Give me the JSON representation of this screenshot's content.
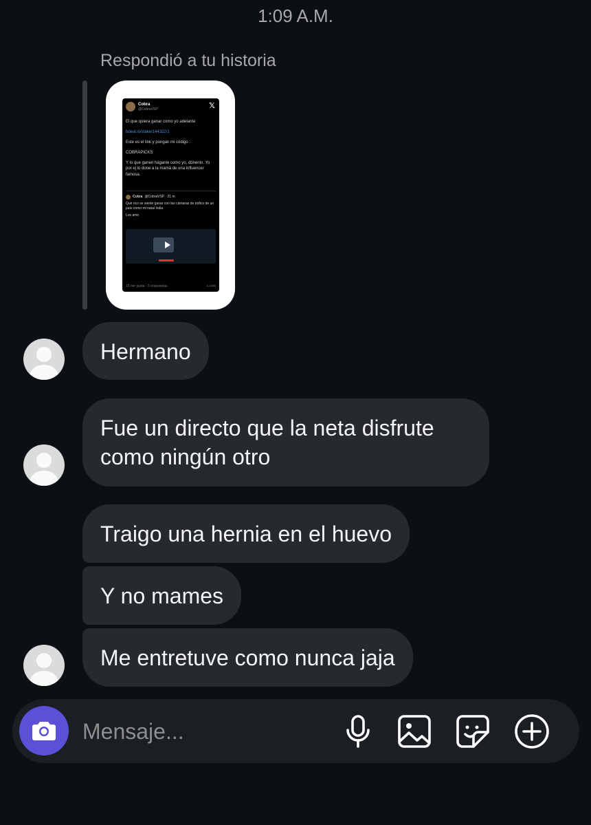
{
  "header": {
    "timestamp": "1:09 A.M."
  },
  "story_reply": {
    "label": "Respondió a tu historia",
    "post": {
      "author_name": "Cobra",
      "author_handle": "@CobraVSP",
      "lines": [
        "El que quiera ganar como yo adelante",
        "bdeal.io/stake/144322/1",
        "Este es el link y pongan mi código :",
        "COBRAPICKS",
        "Y lo que ganen háganle como yo, dónenlo. Yo por ej lo done a la mamá de una influencer famosa."
      ],
      "quote_author": "Cobra",
      "quote_handle": "@CobraVSP · 21 m",
      "quote_text": "Que rico se siente ganar con las cámaras de tráfico de un país como mi natal India",
      "quote_sub": "Los amo",
      "footer_left": "15 me gusta · 5 respuestas",
      "footer_right": "x.com"
    }
  },
  "messages": [
    {
      "text": "Hermano"
    },
    {
      "text": "Fue un directo que la neta disfrute como ningún otro"
    },
    {
      "text": "Traigo una hernia en el huevo"
    },
    {
      "text": "Y no mames"
    },
    {
      "text": "Me entretuve como nunca jaja"
    }
  ],
  "composer": {
    "placeholder": "Mensaje...",
    "icons": [
      "camera-icon",
      "microphone-icon",
      "gallery-icon",
      "sticker-icon",
      "plus-icon"
    ]
  },
  "colors": {
    "background": "#0c1014",
    "bubble": "#262a2f",
    "camera_button": "#5b51d8",
    "muted_text": "#a8a8a8"
  }
}
